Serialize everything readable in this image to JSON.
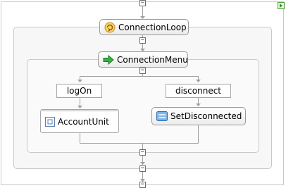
{
  "diagram": {
    "loop": {
      "label": "ConnectionLoop",
      "icon": "loop-icon"
    },
    "menu": {
      "label": "ConnectionMenu",
      "icon": "arrow-right-icon"
    },
    "branches": [
      {
        "label": "logOn",
        "activity": "AccountUnit",
        "icon": "unit-icon"
      },
      {
        "label": "disconnect",
        "activity": "SetDisconnected",
        "icon": "assign-icon"
      }
    ],
    "toggle_symbol": "−",
    "colors": {
      "connector": "#a0a0a0",
      "loop_icon": "#e6a31d",
      "arrow_icon": "#2f9a3a",
      "assign_icon": "#3b7fc4"
    }
  }
}
